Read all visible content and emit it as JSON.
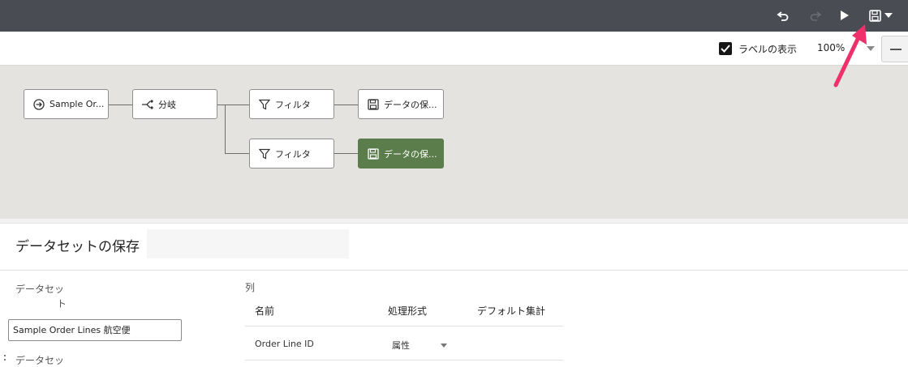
{
  "toolbar": {
    "icons": [
      "undo-icon",
      "redo-icon",
      "run-icon",
      "save-icon",
      "chevron-down-icon"
    ]
  },
  "subbar": {
    "show_labels": "ラベルの表示",
    "show_labels_checked": true,
    "zoom": "100%"
  },
  "flow": {
    "nodes": [
      {
        "label": "Sample Or...",
        "icon": "dataset-icon"
      },
      {
        "label": "分岐",
        "icon": "branch-icon"
      },
      {
        "label": "フィルタ",
        "icon": "filter-icon"
      },
      {
        "label": "データの保...",
        "icon": "save-icon"
      },
      {
        "label": "フィルタ",
        "icon": "filter-icon"
      },
      {
        "label": "データの保...",
        "icon": "save-icon",
        "selected": true
      }
    ]
  },
  "panel": {
    "title": "データセットの保存",
    "dataset_label_line1": "データセッ",
    "dataset_label_line2": "ト",
    "dataset_value": "Sample Order Lines 航空便",
    "dataset_label_cut": "データセッ",
    "columns_label": "列",
    "headers": [
      "名前",
      "処理形式",
      "デフォルト集計"
    ],
    "rows": [
      {
        "name": "Order Line ID",
        "type": "属性",
        "aggregation": ""
      }
    ]
  },
  "colors": {
    "topbar": "#494c52",
    "canvas": "#e4e3df",
    "selected_node": "#5b7d4b",
    "annotation_arrow": "#f0306a"
  }
}
